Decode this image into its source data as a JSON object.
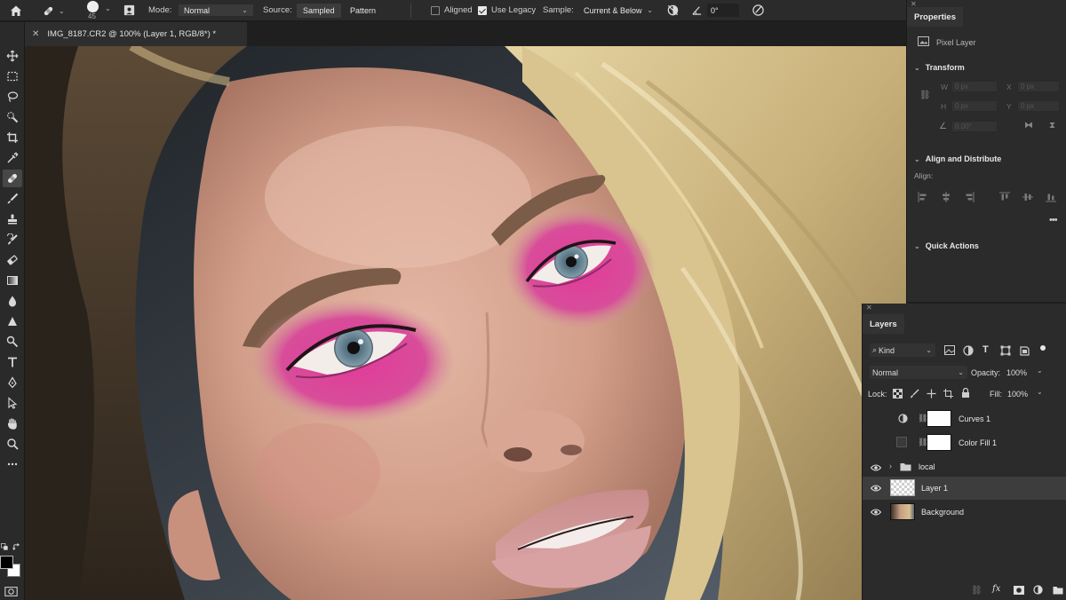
{
  "options_bar": {
    "brush_size": "45",
    "mode_label": "Mode:",
    "mode_value": "Normal",
    "source_label": "Source:",
    "source_sampled": "Sampled",
    "source_pattern": "Pattern",
    "aligned_label": "Aligned",
    "aligned_checked": false,
    "use_legacy_label": "Use Legacy",
    "use_legacy_checked": true,
    "sample_label": "Sample:",
    "sample_value": "Current & Below",
    "angle_value": "0°"
  },
  "document": {
    "tab_title": "IMG_8187.CR2 @ 100% (Layer 1, RGB/8*) *"
  },
  "toolbar": {
    "active_tool": "healing-brush",
    "foreground_color": "#000000",
    "background_color": "#ffffff"
  },
  "properties": {
    "panel_title": "Properties",
    "layer_type": "Pixel Layer",
    "transform_title": "Transform",
    "w_label": "W",
    "h_label": "H",
    "x_label": "X",
    "y_label": "Y",
    "w_value": "0 px",
    "h_value": "0 px",
    "x_value": "0 px",
    "y_value": "0 px",
    "angle_value": "0.00°",
    "align_title": "Align and Distribute",
    "align_label": "Align:",
    "quick_actions_title": "Quick Actions"
  },
  "layers_panel": {
    "panel_title": "Layers",
    "filter_kind": "Kind",
    "blend_mode": "Normal",
    "opacity_label": "Opacity:",
    "opacity_value": "100%",
    "lock_label": "Lock:",
    "fill_label": "Fill:",
    "fill_value": "100%",
    "layers": [
      {
        "name": "Curves 1",
        "visible": false,
        "type": "adjustment"
      },
      {
        "name": "Color Fill 1",
        "visible": false,
        "type": "fill"
      },
      {
        "name": "local",
        "visible": true,
        "type": "group"
      },
      {
        "name": "Layer 1",
        "visible": true,
        "type": "pixel",
        "selected": true
      },
      {
        "name": "Background",
        "visible": true,
        "type": "pixel"
      }
    ]
  },
  "colors": {
    "panel_bg": "#2b2b2b",
    "selected_layer": "#3d3d3d",
    "eyeshadow": "#e0439a"
  }
}
